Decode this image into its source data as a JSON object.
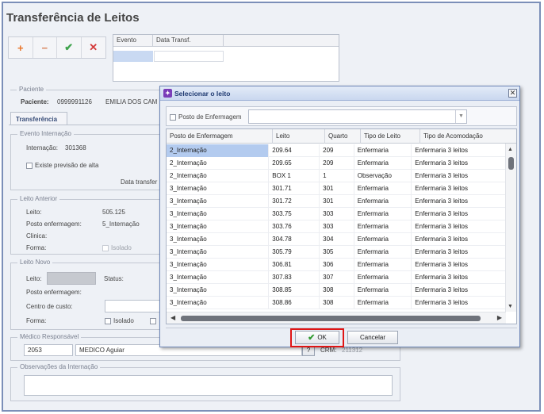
{
  "page": {
    "title": "Transferência de Leitos",
    "toolbar": {
      "add_icon": "+",
      "remove_icon": "−",
      "confirm_icon": "✔",
      "cancel_icon": "✕"
    },
    "event_grid": {
      "col_evento": "Evento",
      "col_data": "Data Transf."
    }
  },
  "paciente": {
    "legend": "Paciente",
    "label": "Paciente:",
    "id": "0999991126",
    "name": "EMILIA DOS CAM"
  },
  "tab": {
    "label": "Transferência"
  },
  "evento_internacao": {
    "legend": "Evento Internação",
    "internacao_label": "Internação:",
    "internacao_value": "301368",
    "previsao_alta": "Existe previsão de alta",
    "data_transf_label": "Data transfer"
  },
  "leito_anterior": {
    "legend": "Leito Anterior",
    "leito_label": "Leito:",
    "leito_value": "505.125",
    "posto_label": "Posto enfermagem:",
    "posto_value": "5_Internação",
    "clinica_label": "Clinica:",
    "forma_label": "Forma:",
    "isolado": "Isolado"
  },
  "leito_novo": {
    "legend": "Leito Novo",
    "leito_label": "Leito:",
    "status_label": "Status:",
    "posto_label": "Posto enfermagem:",
    "centro_label": "Centro de custo:",
    "forma_label": "Forma:",
    "isolado": "Isolado"
  },
  "medico": {
    "legend": "Médico Responsável",
    "code": "2053",
    "name": "MEDICO Aguiar",
    "help": "?",
    "crm_label": "CRM:",
    "crm_value": "211312"
  },
  "observacoes": {
    "legend": "Observações da Internação"
  },
  "modal": {
    "title": "Selecionar o leito",
    "close": "✕",
    "filter_label": "Posto de Enfermagem",
    "columns": [
      "Posto de Enfermagem",
      "Leito",
      "Quarto",
      "Tipo de Leito",
      "Tipo de Acomodação"
    ],
    "rows": [
      [
        "2_Internação",
        "209.64",
        "209",
        "Enfermaria",
        "Enfermaria 3 leitos"
      ],
      [
        "2_Internação",
        "209.65",
        "209",
        "Enfermaria",
        "Enfermaria 3 leitos"
      ],
      [
        "2_Internação",
        "BOX 1",
        "1",
        "Observação",
        "Enfermaria 3 leitos"
      ],
      [
        "3_Internação",
        "301.71",
        "301",
        "Enfermaria",
        "Enfermaria 3 leitos"
      ],
      [
        "3_Internação",
        "301.72",
        "301",
        "Enfermaria",
        "Enfermaria 3 leitos"
      ],
      [
        "3_Internação",
        "303.75",
        "303",
        "Enfermaria",
        "Enfermaria 3 leitos"
      ],
      [
        "3_Internação",
        "303.76",
        "303",
        "Enfermaria",
        "Enfermaria 3 leitos"
      ],
      [
        "3_Internação",
        "304.78",
        "304",
        "Enfermaria",
        "Enfermaria 3 leitos"
      ],
      [
        "3_Internação",
        "305.79",
        "305",
        "Enfermaria",
        "Enfermaria 3 leitos"
      ],
      [
        "3_Internação",
        "306.81",
        "306",
        "Enfermaria",
        "Enfermaria 3 leitos"
      ],
      [
        "3_Internação",
        "307.83",
        "307",
        "Enfermaria",
        "Enfermaria 3 leitos"
      ],
      [
        "3_Internação",
        "308.85",
        "308",
        "Enfermaria",
        "Enfermaria 3 leitos"
      ],
      [
        "3_Internação",
        "308.86",
        "308",
        "Enfermaria",
        "Enfermaria 3 leitos"
      ]
    ],
    "ok_label": "OK",
    "cancel_label": "Cancelar"
  },
  "colors": {
    "accent": "#1e3970",
    "selection": "#b3cbef",
    "highlight_red": "#e01515"
  },
  "icons": {
    "arrow": "red-left-arrow-icon",
    "ok": "green-check-icon",
    "logo": "app-logo-icon"
  }
}
